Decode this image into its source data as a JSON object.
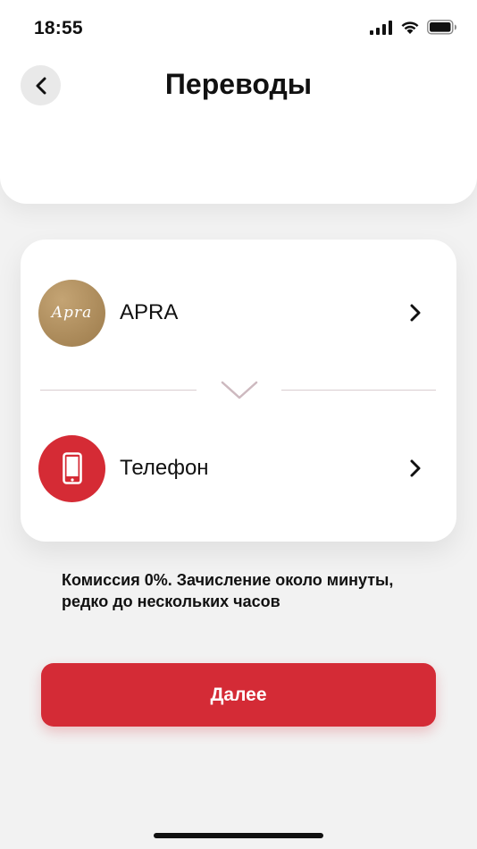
{
  "status_bar": {
    "time": "18:55",
    "icons": [
      "signal-icon",
      "wifi-icon",
      "battery-icon"
    ]
  },
  "header": {
    "title": "Переводы",
    "back_icon": "chevron-left-icon"
  },
  "transfer": {
    "from": {
      "label": "APRA",
      "logo_text": "Apra",
      "avatar_color": "#a88757"
    },
    "to": {
      "label": "Телефон",
      "icon": "phone-icon",
      "avatar_color": "#d52b35"
    },
    "swap_icon": "chevron-down-icon"
  },
  "commission": "Комиссия 0%. Зачисление около минуты, редко до нескольких часов",
  "next_button": {
    "label": "Далее",
    "color": "#d42b36"
  }
}
